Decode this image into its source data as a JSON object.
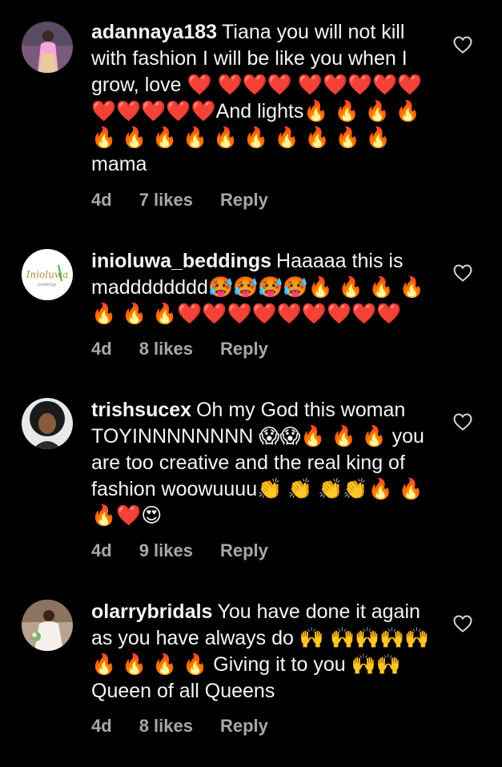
{
  "comments": [
    {
      "username": "adannaya183",
      "text": "Tiana  you will not kill with fashion I will be like you when I grow, love ❤️ ❤️❤️❤️ ❤️❤️❤️❤️❤️❤️❤️❤️❤️❤️And lights🔥 🔥 🔥 🔥 🔥 🔥 🔥 🔥 🔥 🔥 🔥 🔥 🔥 🔥  mama",
      "time": "4d",
      "likes": "7 likes",
      "reply": "Reply",
      "avatar_icon": "avatar-woman-pink-outfit-icon"
    },
    {
      "username": "inioluwa_beddings",
      "text": "Haaaaa this is madddddddd🥵🥵🥵🥵🔥 🔥 🔥 🔥 🔥 🔥 🔥❤️❤️❤️❤️❤️❤️❤️❤️❤️",
      "time": "4d",
      "likes": "8 likes",
      "reply": "Reply",
      "avatar_icon": "avatar-logo-inioluwa-icon"
    },
    {
      "username": "trishsucex",
      "text": "Oh my God this woman TOYINNNNNNNN 😱😱🔥 🔥 🔥 you are too creative and the real king of fashion woowuuuu👏 👏 👏👏🔥 🔥 🔥❤️😍",
      "time": "4d",
      "likes": "9 likes",
      "reply": "Reply",
      "avatar_icon": "avatar-woman-afro-icon"
    },
    {
      "username": "olarrybridals",
      "text": "You have done it again as you have always do 🙌 🙌🙌🙌🙌 🔥 🔥 🔥 🔥 Giving it to you 🙌🙌Queen of all Queens",
      "time": "4d",
      "likes": "8 likes",
      "reply": "Reply",
      "avatar_icon": "avatar-bride-icon"
    }
  ],
  "colors": {
    "background": "#000000",
    "text": "#f5f5f5",
    "meta": "#a8a8a8"
  }
}
